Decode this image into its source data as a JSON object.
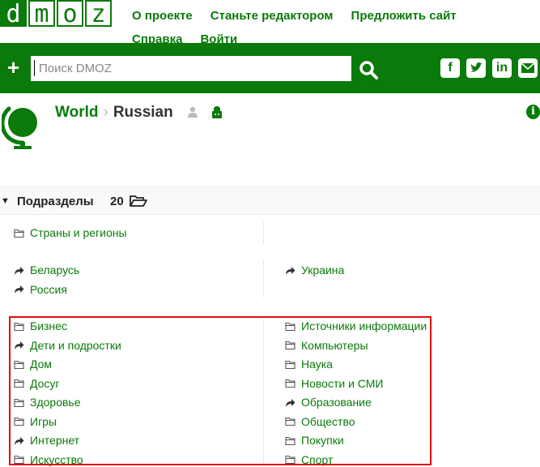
{
  "logo": {
    "letters": [
      "d",
      "m",
      "o",
      "z"
    ]
  },
  "topnav": {
    "items": [
      "О проекте",
      "Станьте редактором",
      "Предложить сайт",
      "Справка",
      "Войти"
    ]
  },
  "search": {
    "placeholder": "Поиск DMOZ",
    "plus": "+"
  },
  "social": [
    "facebook-icon",
    "twitter-icon",
    "linkedin-icon",
    "email-icon"
  ],
  "breadcrumb": {
    "world": "World",
    "separator": "›",
    "current": "Russian"
  },
  "subcategories": {
    "label": "Подразделы",
    "count": "20"
  },
  "regions": [
    "Страны и регионы"
  ],
  "related": {
    "left": [
      "Беларусь",
      "Россия"
    ],
    "right": [
      "Украина"
    ]
  },
  "categories": {
    "left": [
      {
        "label": "Бизнес",
        "icon": "folder"
      },
      {
        "label": "Дети и подростки",
        "icon": "link"
      },
      {
        "label": "Дом",
        "icon": "folder"
      },
      {
        "label": "Досуг",
        "icon": "folder"
      },
      {
        "label": "Здоровье",
        "icon": "folder"
      },
      {
        "label": "Игры",
        "icon": "folder"
      },
      {
        "label": "Интернет",
        "icon": "link"
      },
      {
        "label": "Искусство",
        "icon": "folder"
      }
    ],
    "right": [
      {
        "label": "Источники информации",
        "icon": "folder"
      },
      {
        "label": "Компьютеры",
        "icon": "folder"
      },
      {
        "label": "Наука",
        "icon": "folder"
      },
      {
        "label": "Новости и СМИ",
        "icon": "folder"
      },
      {
        "label": "Образование",
        "icon": "link"
      },
      {
        "label": "Общество",
        "icon": "folder"
      },
      {
        "label": "Покупки",
        "icon": "folder"
      },
      {
        "label": "Спорт",
        "icon": "folder"
      }
    ]
  },
  "colors": {
    "brand": "#0a7a0a",
    "highlight": "#dd1111"
  }
}
